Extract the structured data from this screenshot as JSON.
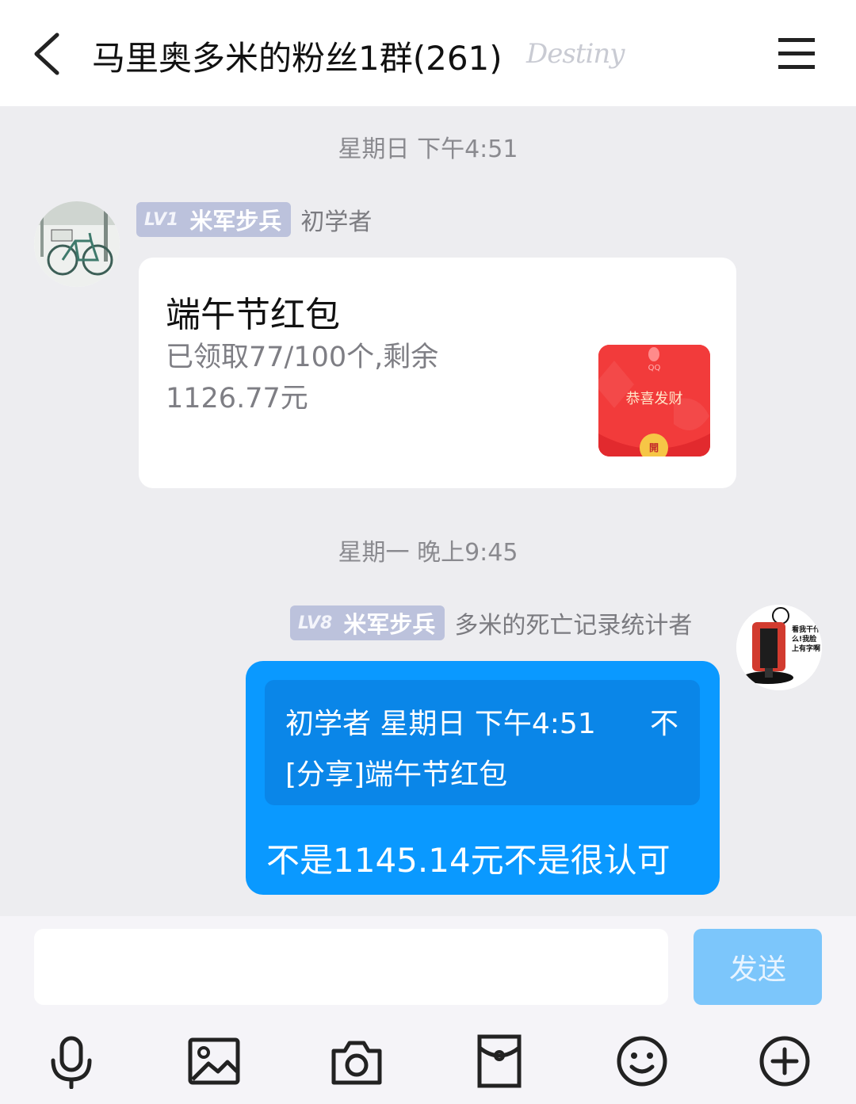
{
  "header": {
    "title": "马里奥多米的粉丝1群(261)",
    "badge": "Destiny"
  },
  "timestamps": [
    "星期日 下午4:51",
    "星期一 晚上9:45"
  ],
  "messages": [
    {
      "sender": {
        "level": "LV1",
        "rank": "米军步兵",
        "nickname": "初学者"
      },
      "red_packet": {
        "title": "端午节红包",
        "status": "已领取77/100个,剩余1126.77元",
        "cover_brand": "QQ",
        "cover_text": "恭喜发财",
        "open_label": "開"
      }
    },
    {
      "sender": {
        "level": "LV8",
        "rank": "米军步兵",
        "nickname": "多米的死亡记录统计者",
        "avatar_text": "看我干什么!我脸上有字啊"
      },
      "quote": {
        "header": "初学者 星期日 下午4:51",
        "trailing": "不",
        "body": "[分享]端午节红包"
      },
      "text": "不是1145.14元不是很认可"
    }
  ],
  "composer": {
    "input_value": "",
    "send_label": "发送"
  },
  "toolbar": [
    "microphone-icon",
    "image-icon",
    "camera-icon",
    "red-packet-icon",
    "emoji-icon",
    "plus-icon"
  ],
  "colors": {
    "background": "#ededf0",
    "bubble": "#0a99ff",
    "quote": "#0a86e8",
    "level_badge": "#bcc2dc",
    "send_button": "#7cc6fb",
    "red_packet": "#f23b3b"
  }
}
